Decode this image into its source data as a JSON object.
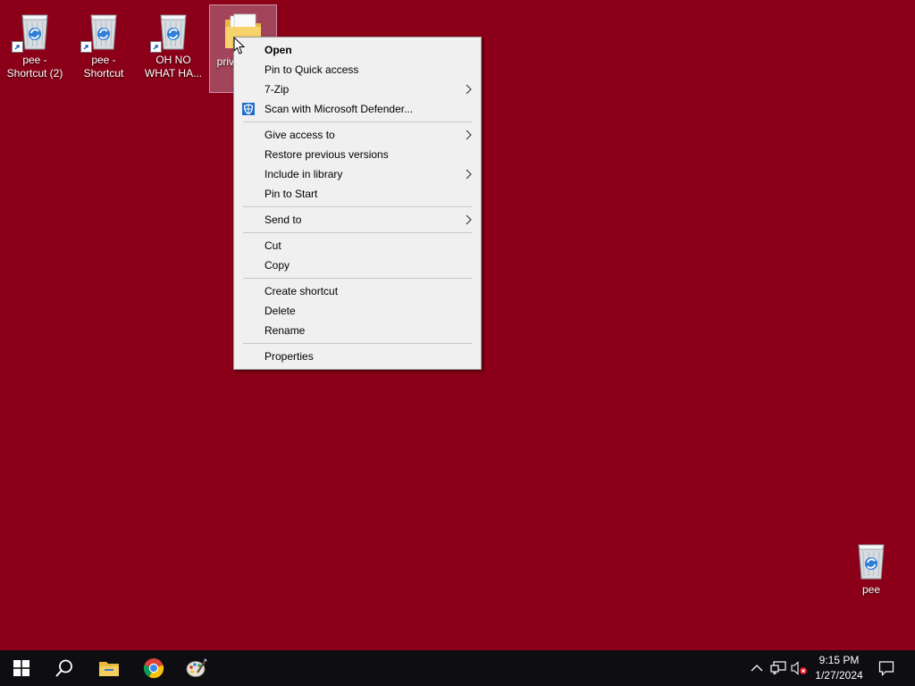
{
  "desktop": {
    "background_color": "#8b0018",
    "icons": [
      {
        "label": "pee - Shortcut (2)",
        "icon": "recycle-bin-icon",
        "shortcut": true
      },
      {
        "label": "pee - Shortcut",
        "icon": "recycle-bin-icon",
        "shortcut": true
      },
      {
        "label": "OH NO WHAT HA...",
        "icon": "recycle-bin-icon",
        "shortcut": true
      },
      {
        "label": "priva... pl... t...",
        "icon": "folder-icon",
        "shortcut": false,
        "selected": true
      },
      {
        "label": "pee",
        "icon": "recycle-bin-icon",
        "shortcut": false
      }
    ]
  },
  "context_menu": {
    "items": [
      {
        "label": "Open",
        "bold": true
      },
      {
        "label": "Pin to Quick access"
      },
      {
        "label": "7-Zip",
        "submenu": true
      },
      {
        "label": "Scan with Microsoft Defender...",
        "icon": "defender-shield-icon"
      },
      {
        "label": "Give access to",
        "submenu": true
      },
      {
        "label": "Restore previous versions"
      },
      {
        "label": "Include in library",
        "submenu": true
      },
      {
        "label": "Pin to Start"
      },
      {
        "label": "Send to",
        "submenu": true
      },
      {
        "label": "Cut"
      },
      {
        "label": "Copy"
      },
      {
        "label": "Create shortcut"
      },
      {
        "label": "Delete"
      },
      {
        "label": "Rename"
      },
      {
        "label": "Properties"
      }
    ]
  },
  "taskbar": {
    "background_color": "#0d0d12",
    "pinned": [
      {
        "icon": "windows-start-icon"
      },
      {
        "icon": "search-icon"
      },
      {
        "icon": "file-explorer-icon"
      },
      {
        "icon": "chrome-icon"
      },
      {
        "icon": "paint-icon"
      }
    ],
    "tray": [
      {
        "icon": "chevron-up-icon"
      },
      {
        "icon": "network-icon"
      },
      {
        "icon": "volume-muted-icon"
      }
    ],
    "clock": {
      "time": "9:15 PM",
      "date": "1/27/2024"
    },
    "notification_icon": "notification-icon"
  }
}
